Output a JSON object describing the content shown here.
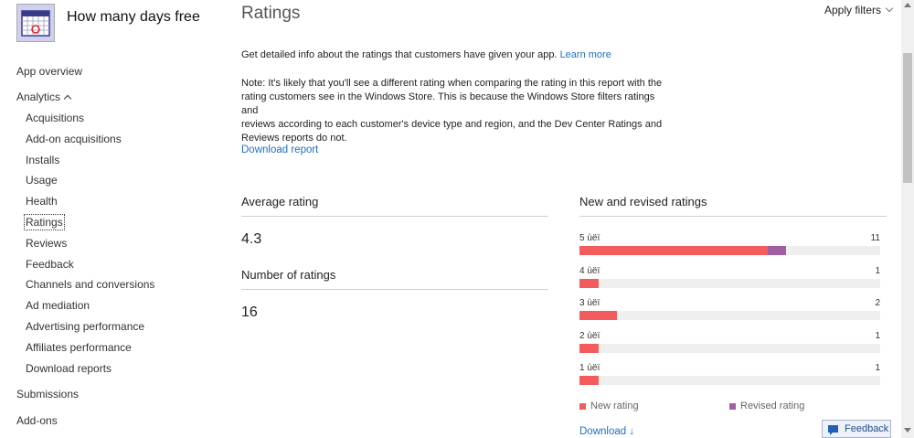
{
  "app": {
    "name": "How many days free",
    "icon": "calendar-app-icon"
  },
  "sidebar": {
    "overview": "App overview",
    "analytics": "Analytics",
    "analytics_items": [
      "Acquisitions",
      "Add-on acquisitions",
      "Installs",
      "Usage",
      "Health",
      "Ratings",
      "Reviews",
      "Feedback",
      "Channels and conversions",
      "Ad mediation",
      "Advertising performance",
      "Affiliates performance",
      "Download reports"
    ],
    "active_item": "Ratings",
    "submissions": "Submissions",
    "addons": "Add-ons"
  },
  "page": {
    "title": "Ratings",
    "apply_filters": "Apply filters",
    "intro_text": "Get detailed info about the ratings that customers have given your app.",
    "learn_more": "Learn more",
    "note_lines": [
      "Note: It's likely that you'll see a different rating when comparing the rating in this report with the",
      "rating customers see in the Windows Store. This is because the Windows Store filters ratings and",
      "reviews according to each customer's device type and region, and the Dev Center Ratings and",
      "Reviews reports do not."
    ],
    "download_report": "Download report",
    "average_rating_label": "Average rating",
    "average_rating_value": "4.3",
    "number_ratings_label": "Number of ratings",
    "number_ratings_value": "16",
    "chart_title": "New and revised ratings",
    "download": "Download",
    "feedback": "Feedback"
  },
  "colors": {
    "new_rating": "#f25c5c",
    "revised_rating": "#a05fa0",
    "link": "#1e6fc4",
    "track": "#efefef"
  },
  "chart_data": {
    "type": "bar",
    "title": "New and revised ratings",
    "categories": [
      "5 ùëï",
      "4 ùëï",
      "3 ùëï",
      "2 ùëï",
      "1 ùëï"
    ],
    "totals": [
      11,
      1,
      2,
      1,
      1
    ],
    "series": [
      {
        "name": "New rating",
        "values": [
          10,
          1,
          2,
          1,
          1
        ]
      },
      {
        "name": "Revised rating",
        "values": [
          1,
          0,
          0,
          0,
          0
        ]
      }
    ],
    "xlim": [
      0,
      16
    ],
    "legend": "bottom"
  }
}
